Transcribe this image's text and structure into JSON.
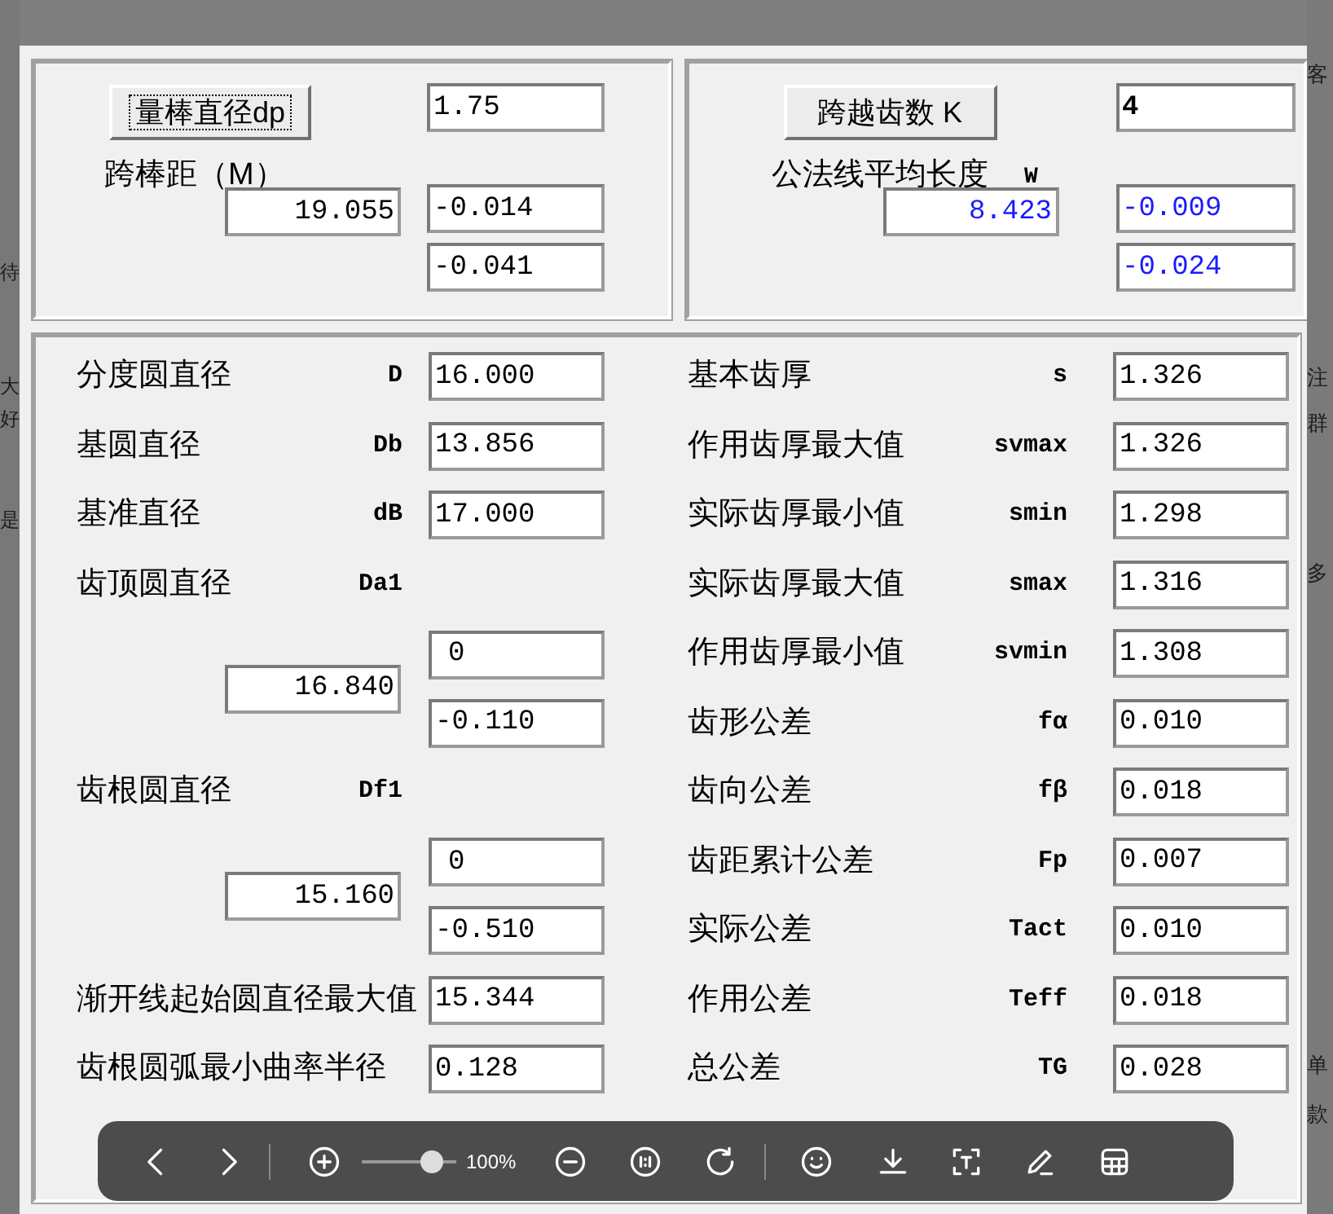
{
  "background_page": {
    "left_fragments": [
      "待",
      "大",
      "好",
      "是"
    ],
    "right_fragments": [
      "客",
      "注",
      "群",
      "多",
      "单",
      "款"
    ]
  },
  "dialog": {
    "top_left": {
      "button": "量棒直径dp",
      "dp_value": "1.75",
      "label": "跨棒距（M）",
      "value": "19.055",
      "upper_deviation": "-0.014",
      "lower_deviation": "-0.041"
    },
    "top_right": {
      "button": "跨越齿数 K",
      "k_value": "4",
      "label": "公法线平均长度",
      "symbol": "W",
      "value": "8.423",
      "upper_deviation": "-0.009",
      "lower_deviation": "-0.024"
    },
    "left_rows": [
      {
        "kind": "single",
        "label": "分度圆直径",
        "symbol": "D",
        "value": "16.000"
      },
      {
        "kind": "single",
        "label": "基圆直径",
        "symbol": "Db",
        "value": "13.856"
      },
      {
        "kind": "single",
        "label": "基准直径",
        "symbol": "dB",
        "value": "17.000"
      },
      {
        "kind": "header",
        "label": "齿顶圆直径",
        "symbol": "Da1"
      },
      {
        "kind": "range",
        "value": "16.840",
        "upper_deviation": "0",
        "lower_deviation": "-0.110"
      },
      {
        "kind": "header",
        "label": "齿根圆直径",
        "symbol": "Df1"
      },
      {
        "kind": "range",
        "value": "15.160",
        "upper_deviation": "0",
        "lower_deviation": "-0.510"
      },
      {
        "kind": "single",
        "label": "渐开线起始圆直径最大值",
        "value": "15.344"
      },
      {
        "kind": "single",
        "label": "齿根圆弧最小曲率半径",
        "value": "0.128"
      }
    ],
    "right_rows": [
      {
        "label": "基本齿厚",
        "symbol": "s",
        "value": "1.326"
      },
      {
        "label": "作用齿厚最大值",
        "symbol": "svmax",
        "value": "1.326"
      },
      {
        "label": "实际齿厚最小值",
        "symbol": "smin",
        "value": "1.298"
      },
      {
        "label": "实际齿厚最大值",
        "symbol": "smax",
        "value": "1.316"
      },
      {
        "label": "作用齿厚最小值",
        "symbol": "svmin",
        "value": "1.308"
      },
      {
        "label": "齿形公差",
        "symbol": "fα",
        "value": "0.010"
      },
      {
        "label": "齿向公差",
        "symbol": "fβ",
        "value": "0.018"
      },
      {
        "label": "齿距累计公差",
        "symbol": "Fp",
        "value": "0.007"
      },
      {
        "label": "实际公差",
        "symbol": "Tact",
        "value": "0.010"
      },
      {
        "label": "作用公差",
        "symbol": "Teff",
        "value": "0.018"
      },
      {
        "label": "总公差",
        "symbol": "TG",
        "value": "0.028"
      }
    ]
  },
  "viewer_toolbar": {
    "zoom": {
      "level": 0.74,
      "reading": "100%"
    }
  }
}
